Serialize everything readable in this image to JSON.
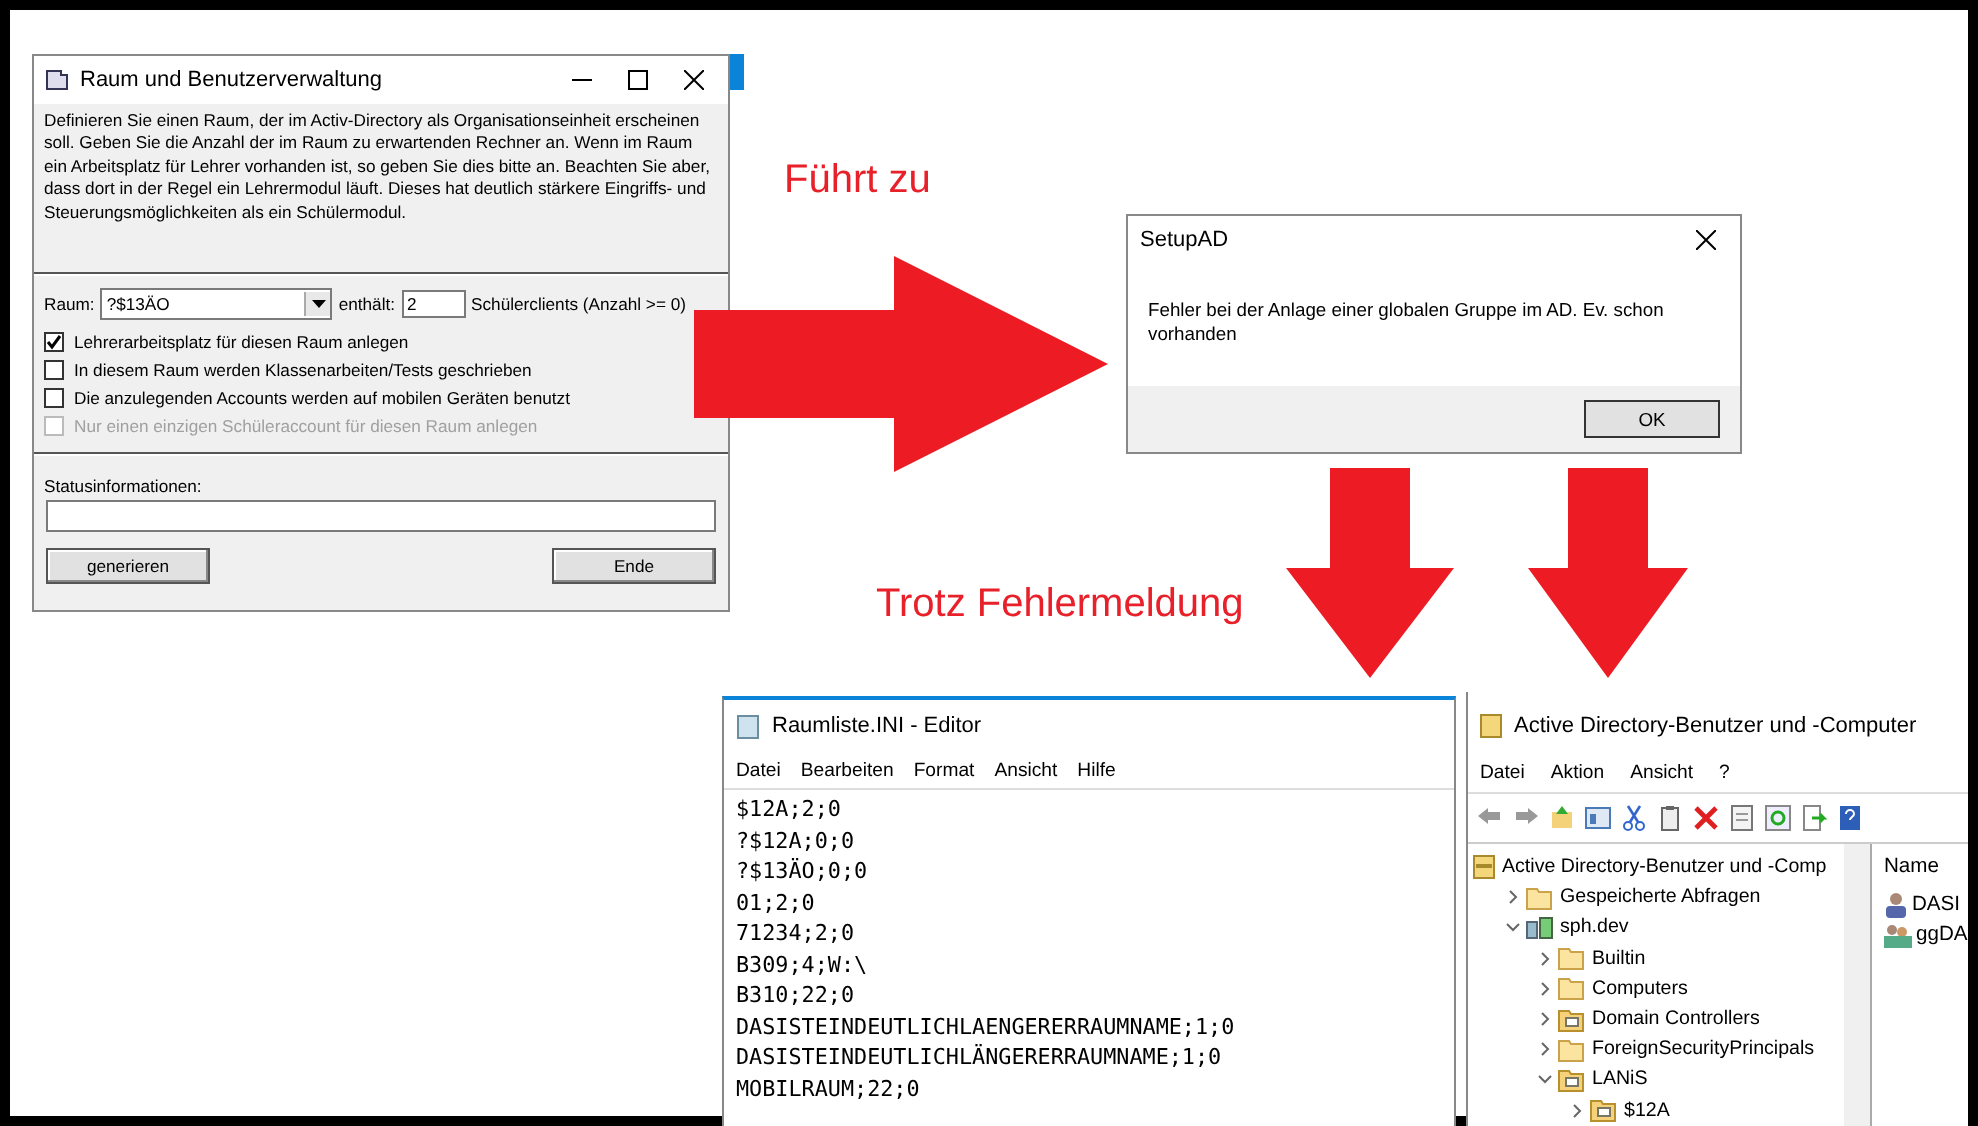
{
  "room_dialog": {
    "title": "Raum und Benutzerverwaltung",
    "description": "Definieren Sie einen Raum, der im Activ-Directory als Organisationseinheit erscheinen soll. Geben Sie die Anzahl der im Raum zu erwartenden Rechner an. Wenn im Raum ein Arbeitsplatz für Lehrer vorhanden ist, so geben Sie dies bitte an. Beachten Sie aber, dass dort in der Regel ein Lehrermodul läuft. Dieses hat deutlich stärkere Eingriffs- und Steuerungsmöglichkeiten als ein Schülermodul.",
    "room_label": "Raum:",
    "room_value": "?$13ÄO",
    "contains_label": "enthält:",
    "count_value": "2",
    "count_hint": "Schülerclients (Anzahl >= 0)",
    "options": [
      {
        "label": "Lehrerarbeitsplatz für diesen Raum anlegen",
        "checked": true,
        "disabled": false
      },
      {
        "label": "In diesem Raum werden Klassenarbeiten/Tests geschrieben",
        "checked": false,
        "disabled": false
      },
      {
        "label": "Die anzulegenden Accounts werden auf mobilen Geräten benutzt",
        "checked": false,
        "disabled": false
      },
      {
        "label": "Nur einen einzigen Schüleraccount für diesen Raum anlegen",
        "checked": false,
        "disabled": true
      }
    ],
    "status_label": "Statusinformationen:",
    "buttons": [
      "generieren",
      "Ende"
    ]
  },
  "annotations": [
    "Führt zu",
    "Trotz Fehlermeldung"
  ],
  "error_dialog": {
    "title": "SetupAD",
    "message": "Fehler bei der Anlage einer globalen Gruppe im AD. Ev. schon vorhanden",
    "button": "OK"
  },
  "editor": {
    "title": "Raumliste.INI - Editor",
    "menu": [
      "Datei",
      "Bearbeiten",
      "Format",
      "Ansicht",
      "Hilfe"
    ],
    "lines": [
      "$12A;2;0",
      "?$12A;0;0",
      "?$13ÄO;0;0",
      "01;2;0",
      "71234;2;0",
      "B309;4;W:\\",
      "B310;22;0",
      "DASISTEINDEUTLICHLAENGERERRAUMNAME;1;0",
      "DASISTEINDEUTLICHLÄNGERERRAUMNAME;1;0",
      "MOBILRAUM;22;0"
    ]
  },
  "ad_window": {
    "title": "Active Directory-Benutzer und -Computer",
    "menu": [
      "Datei",
      "Aktion",
      "Ansicht",
      "?"
    ],
    "tree": [
      {
        "label": "Active Directory-Benutzer und -Comp",
        "kind": "root",
        "children": [
          {
            "label": "Gespeicherte Abfragen",
            "kind": "folder",
            "expanded": false
          },
          {
            "label": "sph.dev",
            "kind": "domain",
            "expanded": true,
            "children": [
              {
                "label": "Builtin",
                "kind": "folder",
                "expanded": false
              },
              {
                "label": "Computers",
                "kind": "folder",
                "expanded": false
              },
              {
                "label": "Domain Controllers",
                "kind": "ou",
                "expanded": false
              },
              {
                "label": "ForeignSecurityPrincipals",
                "kind": "folder",
                "expanded": false
              },
              {
                "label": "LANiS",
                "kind": "ou",
                "expanded": true,
                "children": [
                  {
                    "label": "$12A",
                    "kind": "ou",
                    "expanded": false
                  }
                ]
              }
            ]
          }
        ]
      }
    ],
    "list_header": "Name",
    "list_items": [
      {
        "label": "DASI",
        "kind": "user"
      },
      {
        "label": "ggDA",
        "kind": "group"
      }
    ]
  }
}
